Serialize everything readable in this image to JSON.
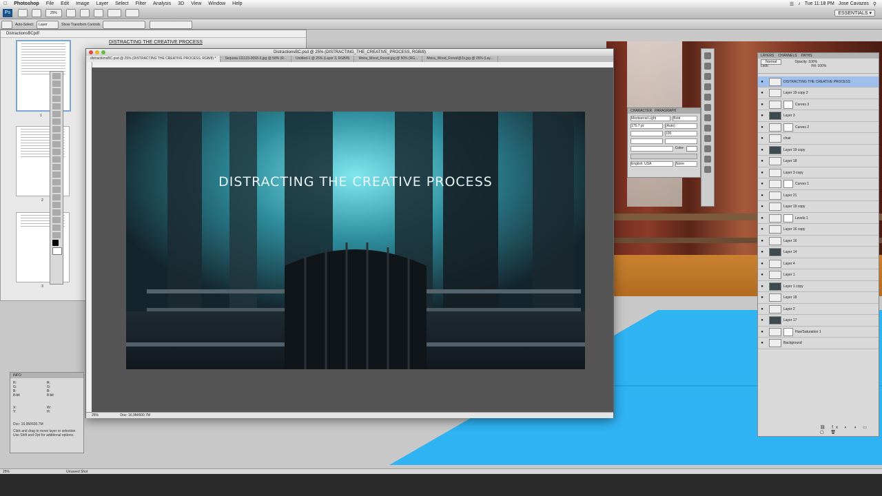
{
  "menubar": {
    "apple": "",
    "app": "Photoshop",
    "items": [
      "File",
      "Edit",
      "Image",
      "Layer",
      "Select",
      "Filter",
      "Analysis",
      "3D",
      "View",
      "Window",
      "Help"
    ],
    "clock": "Tue 11:18 PM",
    "user": "Jose Cavazos"
  },
  "appbar": {
    "ps": "Ps",
    "zoom": "25%",
    "essentials": "ESSENTIALS ▾"
  },
  "optbar": {
    "auto_select": "Auto-Select:",
    "auto_select_value": "Layer",
    "transform": "Show Transform Controls"
  },
  "pdf": {
    "tab": "DistractionsBCpdf",
    "heading": "DISTRACTING THE CREATIVE PROCESS",
    "page_nums": [
      "1",
      "2",
      "3"
    ]
  },
  "doc": {
    "title": "DistractionsBC.psd @ 25% (DISTRACTING_THE_CREATIVE_PROCESS, RGB/8)",
    "tabs": [
      "distractionsBC.psd @ 25% (DISTRACTING THE CREATIVE PROCESS, RGB/8) *",
      "Sequoia-111123-0093-3.jpg @ 58% (R...",
      "Untitled-1 @ 25% (Layer 3, RGB/8)",
      "Moira_Wood_Forest.jpg @ 50% (RG...",
      "Moira_Wood_Forest@2x.jpg @ 25% (Lay..."
    ],
    "status_zoom": "25%",
    "status_doc": "Doc: 16.9M/600.7M"
  },
  "artwork": {
    "title": "DISTRACTING THE CREATIVE PROCESS"
  },
  "character": {
    "tabs": [
      "CHARACTER",
      "PARAGRAPH"
    ],
    "font": "Montserrat Light",
    "style": "Bold",
    "size": "175.7 pt",
    "leading": "(Auto)",
    "tracking": "100",
    "language": "English: USA",
    "aa": "None",
    "color_label": "Color:"
  },
  "layers": {
    "tabs": [
      "LAYERS",
      "CHANNELS",
      "PATHS"
    ],
    "blend": "Normal",
    "opacity": "Opacity: 100%",
    "fill": "Fill: 100%",
    "lock": "Lock:",
    "rows": [
      "DISTRACTING THE CREATIVE PROCESS",
      "Layer 19 copy 2",
      "Curves 3",
      "Layer 3",
      "Curves 2",
      "chair",
      "Layer 19 copy",
      "Layer 18",
      "Layer 3 copy",
      "Curves 1",
      "Layer 21",
      "Layer 19 copy",
      "Levels 1",
      "Layer 16 copy",
      "Layer 16",
      "Layer 14",
      "Layer 4",
      "Layer 1",
      "Layer 1 copy",
      "Layer 18",
      "Layer 2",
      "Layer 17",
      "Hue/Saturation 1",
      "Background"
    ]
  },
  "info": {
    "title": "INFO",
    "r": "R:",
    "g": "G:",
    "b": "B:",
    "bits": "8-bit",
    "x": "X:",
    "y": "Y:",
    "w": "W:",
    "h": "H:",
    "doc": "Doc: 16.9M/600.7M",
    "msg": "Click and drag to move layer or selection. Use Shift and Opt for additional options."
  },
  "bottombar": {
    "zoom": "25%",
    "unsaved": "Unsaved Shot"
  },
  "colors": {
    "accent_blue": "#2fb3f3",
    "selected_layer": "#9fc0ec",
    "artwork_teal": "#49c7d6"
  }
}
